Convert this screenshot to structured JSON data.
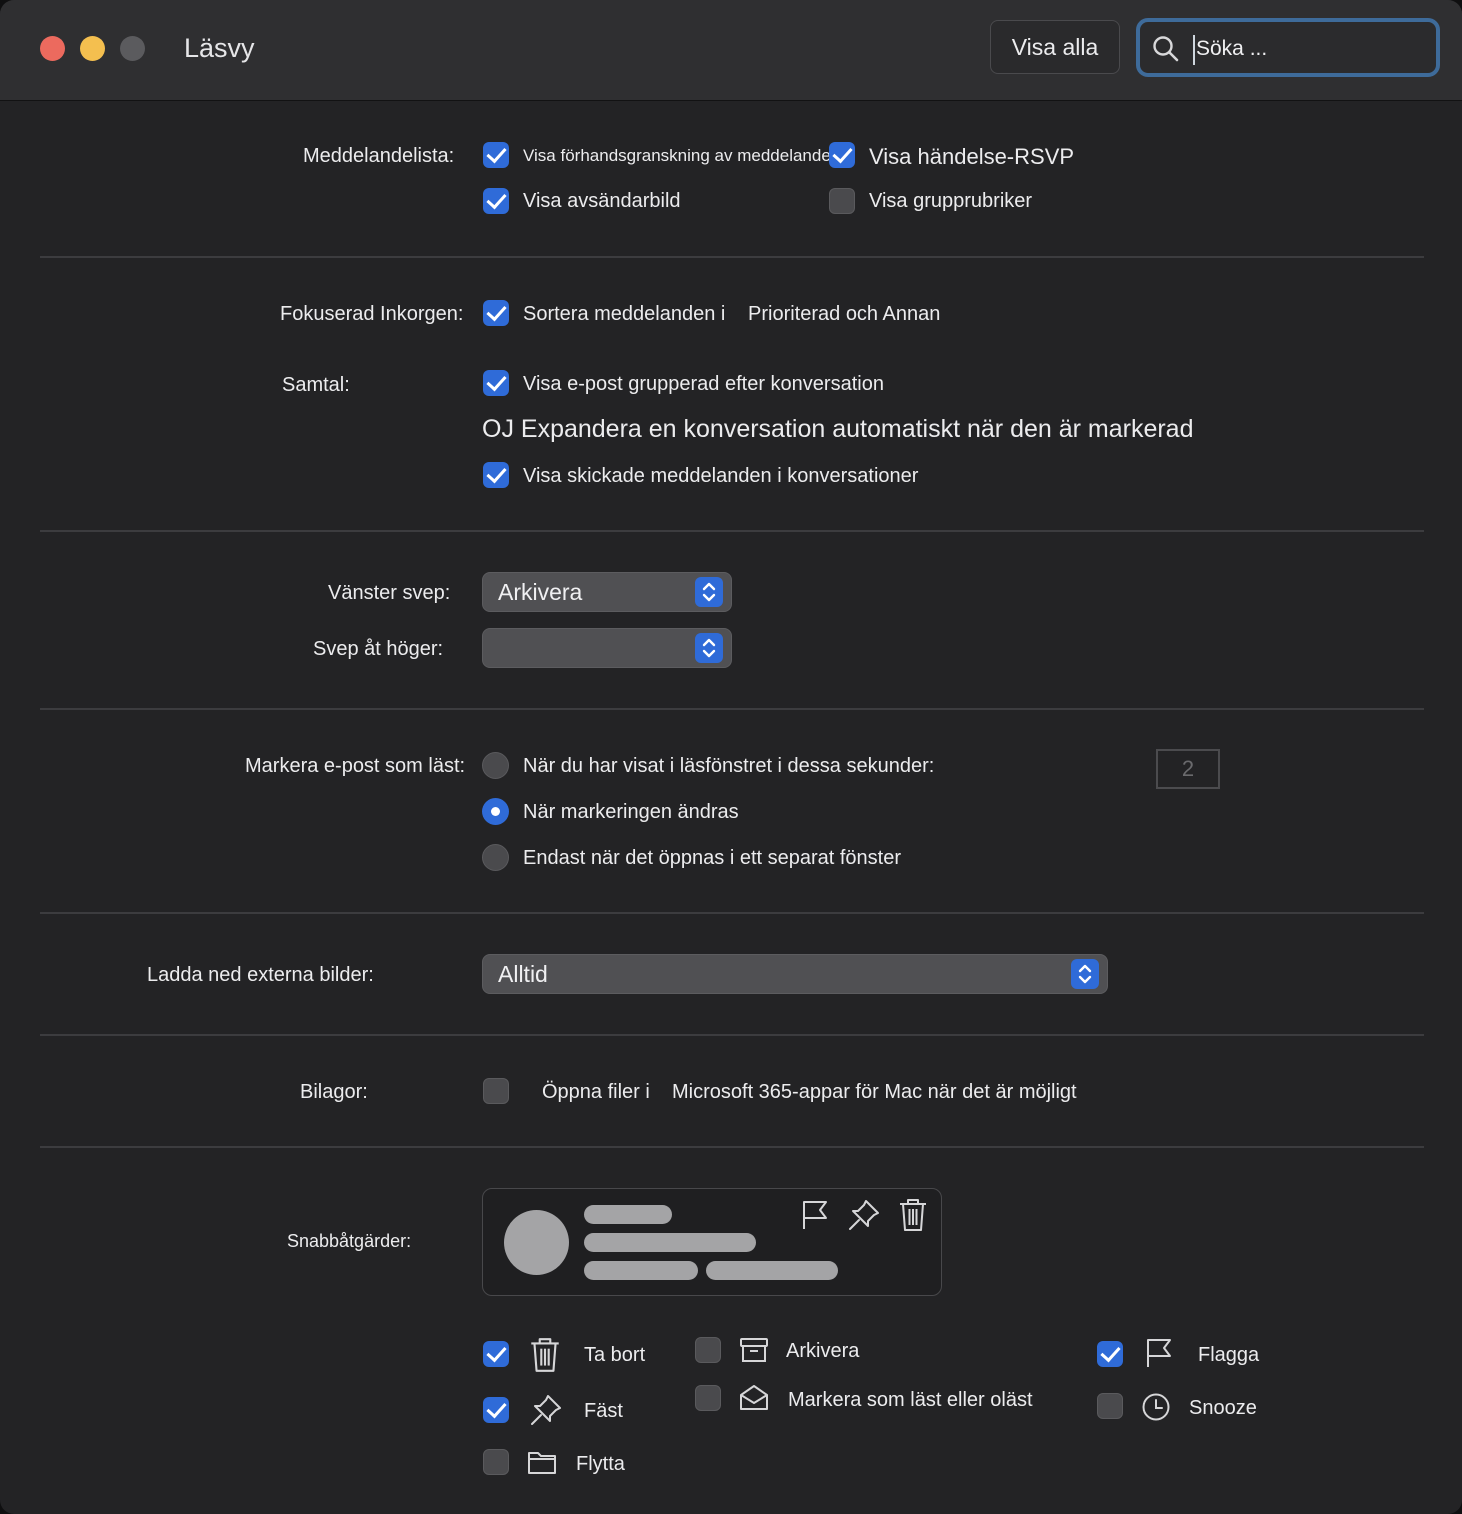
{
  "window": {
    "title": "Läsvy",
    "show_all_label": "Visa alla",
    "search_placeholder": "Söka ..."
  },
  "message_list": {
    "label": "Meddelandelista:",
    "options": [
      {
        "label": "Visa förhandsgranskning av meddelande",
        "checked": true
      },
      {
        "label": "Visa händelse-RSVP",
        "checked": true
      },
      {
        "label": "Visa avsändarbild",
        "checked": true
      },
      {
        "label": "Visa grupprubriker",
        "checked": false
      }
    ]
  },
  "focused_inbox": {
    "label": "Fokuserad Inkorgen:",
    "option_label": "Sortera meddelanden i",
    "option_suffix": "Prioriterad och Annan",
    "checked": true
  },
  "conversations": {
    "label": "Samtal:",
    "group_label": "Visa e-post grupperad efter konversation",
    "group_checked": true,
    "expand_label": "OJ Expandera en konversation automatiskt när den är markerad",
    "sent_label": "Visa skickade meddelanden i konversationer",
    "sent_checked": true
  },
  "swipe": {
    "left_label": "Vänster svep:",
    "left_value": "Arkivera",
    "right_label": "Svep åt höger:",
    "right_value": ""
  },
  "mark_read": {
    "label": "Markera e-post som läst:",
    "options": [
      {
        "label": "När du har visat i läsfönstret i dessa sekunder:",
        "selected": false
      },
      {
        "label": "När markeringen ändras",
        "selected": true
      },
      {
        "label": "Endast när det öppnas i ett separat fönster",
        "selected": false
      }
    ],
    "seconds": "2"
  },
  "external_images": {
    "label": "Ladda ned externa bilder:",
    "value": "Alltid"
  },
  "attachments": {
    "label": "Bilagor:",
    "option_label": "Öppna filer i",
    "option_suffix": "Microsoft 365-appar för Mac när det är möjligt",
    "checked": false
  },
  "quick_actions": {
    "label": "Snabbåtgärder:",
    "preview_icons": [
      "flag-icon",
      "pin-icon",
      "trash-icon"
    ],
    "actions": [
      {
        "label": "Ta bort",
        "icon": "trash-icon",
        "checked": true
      },
      {
        "label": "Fäst",
        "icon": "pin-icon",
        "checked": true
      },
      {
        "label": "Flytta",
        "icon": "folder-icon",
        "checked": false
      },
      {
        "label": "Arkivera",
        "icon": "archive-icon",
        "checked": false
      },
      {
        "label": "Markera som läst eller oläst",
        "icon": "envelope-open-icon",
        "checked": false
      },
      {
        "label": "Flagga",
        "icon": "flag-icon",
        "checked": true
      },
      {
        "label": "Snooze",
        "icon": "clock-icon",
        "checked": false
      }
    ]
  },
  "colors": {
    "accent": "#2f6bd8",
    "background": "#232325",
    "titlebar": "#2f2f31",
    "search_focus_ring": "#3e6b9a"
  }
}
